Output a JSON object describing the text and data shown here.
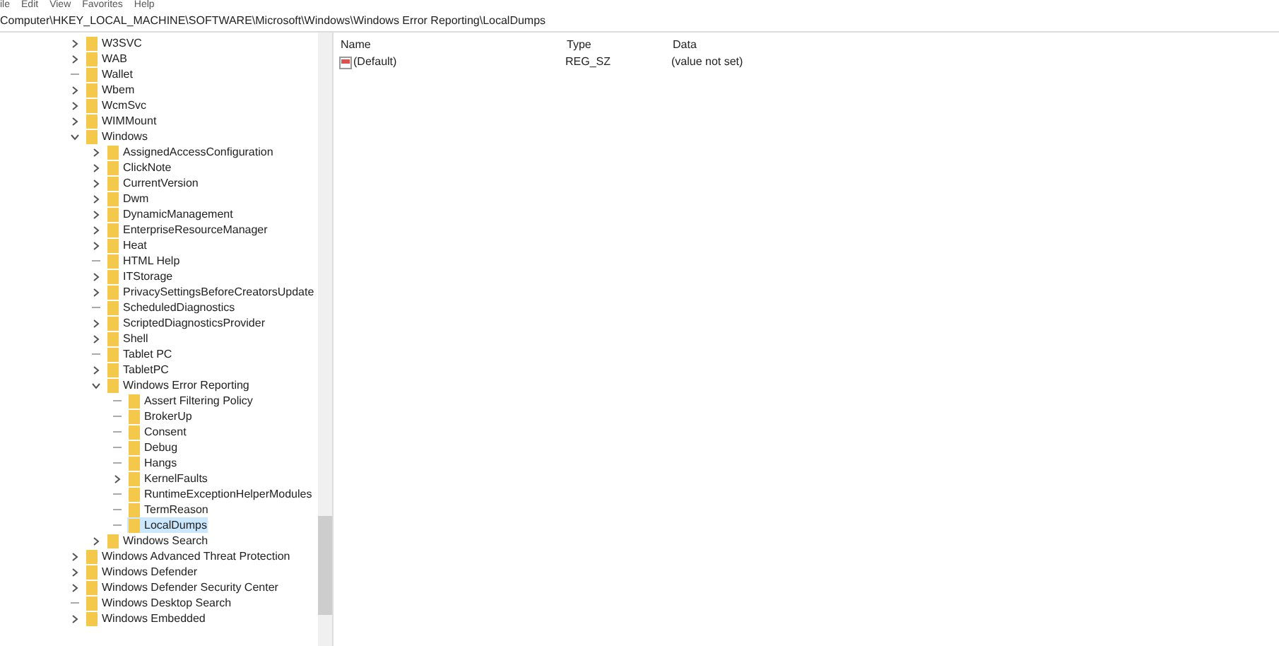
{
  "menu": [
    "ile",
    "Edit",
    "View",
    "Favorites",
    "Help"
  ],
  "address": "Computer\\HKEY_LOCAL_MACHINE\\SOFTWARE\\Microsoft\\Windows\\Windows Error Reporting\\LocalDumps",
  "tree": [
    {
      "label": "W3SVC",
      "expanded": false,
      "selected": false
    },
    {
      "label": "WAB",
      "expanded": false,
      "selected": false
    },
    {
      "label": "Wallet",
      "selected": false
    },
    {
      "label": "Wbem",
      "expanded": false,
      "selected": false
    },
    {
      "label": "WcmSvc",
      "expanded": false,
      "selected": false
    },
    {
      "label": "WIMMount",
      "expanded": false,
      "selected": false
    },
    {
      "label": "Windows",
      "expanded": true,
      "selected": false,
      "children": [
        {
          "label": "AssignedAccessConfiguration",
          "expanded": false,
          "selected": false
        },
        {
          "label": "ClickNote",
          "expanded": false,
          "selected": false
        },
        {
          "label": "CurrentVersion",
          "expanded": false,
          "selected": false
        },
        {
          "label": "Dwm",
          "expanded": false,
          "selected": false
        },
        {
          "label": "DynamicManagement",
          "expanded": false,
          "selected": false
        },
        {
          "label": "EnterpriseResourceManager",
          "expanded": false,
          "selected": false
        },
        {
          "label": "Heat",
          "expanded": false,
          "selected": false
        },
        {
          "label": "HTML Help",
          "selected": false
        },
        {
          "label": "ITStorage",
          "expanded": false,
          "selected": false
        },
        {
          "label": "PrivacySettingsBeforeCreatorsUpdate",
          "expanded": false,
          "selected": false
        },
        {
          "label": "ScheduledDiagnostics",
          "selected": false
        },
        {
          "label": "ScriptedDiagnosticsProvider",
          "expanded": false,
          "selected": false
        },
        {
          "label": "Shell",
          "expanded": false,
          "selected": false
        },
        {
          "label": "Tablet PC",
          "selected": false
        },
        {
          "label": "TabletPC",
          "expanded": false,
          "selected": false
        },
        {
          "label": "Windows Error Reporting",
          "expanded": true,
          "selected": false,
          "children": [
            {
              "label": "Assert Filtering Policy",
              "selected": false
            },
            {
              "label": "BrokerUp",
              "selected": false
            },
            {
              "label": "Consent",
              "selected": false
            },
            {
              "label": "Debug",
              "selected": false
            },
            {
              "label": "Hangs",
              "selected": false
            },
            {
              "label": "KernelFaults",
              "expanded": false,
              "selected": false
            },
            {
              "label": "RuntimeExceptionHelperModules",
              "selected": false
            },
            {
              "label": "TermReason",
              "selected": false
            },
            {
              "label": "LocalDumps",
              "selected": true
            }
          ]
        },
        {
          "label": "Windows Search",
          "expanded": false,
          "selected": false
        }
      ]
    },
    {
      "label": "Windows Advanced Threat Protection",
      "expanded": false,
      "selected": false
    },
    {
      "label": "Windows Defender",
      "expanded": false,
      "selected": false
    },
    {
      "label": "Windows Defender Security Center",
      "expanded": false,
      "selected": false
    },
    {
      "label": "Windows Desktop Search",
      "selected": false
    },
    {
      "label": "Windows Embedded",
      "expanded": false,
      "selected": false
    }
  ],
  "values": {
    "columns": [
      "Name",
      "Type",
      "Data"
    ],
    "rows": [
      {
        "name": "(Default)",
        "type": "REG_SZ",
        "data": "(value not set)"
      }
    ]
  }
}
